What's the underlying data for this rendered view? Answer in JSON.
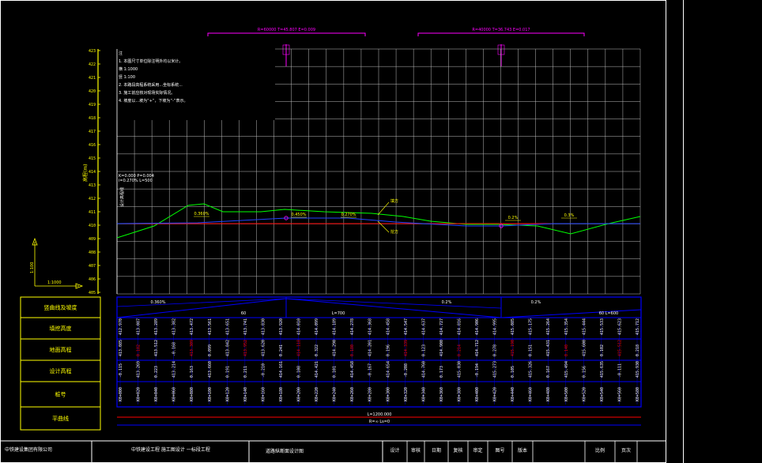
{
  "frame": {
    "bg": "#000000",
    "line": "#ffffff",
    "grid": "#c0c0c0",
    "yellow": "#ffff00",
    "magenta": "#ff00ff",
    "blue": "#0000ff",
    "red": "#ff0000",
    "green": "#00ff00"
  },
  "top_curves": [
    {
      "label": "R=60000 T=45.807 E=0.009"
    },
    {
      "label": "R=40000 T=36.743 E=0.017"
    }
  ],
  "notes": [
    "注",
    "1. 本图尺寸单位除注明外均以米计。",
    "   横 1:1000",
    "   竖 1:100",
    "2. 本路段高程系统采用...坐标系统...",
    "3. 施工前应核对现场实际情况。",
    "4. 坡度以...坡为“+”，下坡为“-”表示。"
  ],
  "profile_small_labels": [
    "K=0.000 P=0.004",
    "i=0.270% L=500"
  ],
  "profile_vlabel": "设计高程线",
  "slope_labels": [
    "0.360%",
    "0.450%",
    "0.270%",
    "0.2%",
    "0.3%"
  ],
  "side_tags": [
    "填方",
    "挖方"
  ],
  "yscale": [
    "423",
    "422",
    "421",
    "420",
    "419",
    "418",
    "417",
    "416",
    "415",
    "414",
    "413",
    "412",
    "411",
    "410",
    "409",
    "408",
    "407",
    "406",
    "405"
  ],
  "yscale_vlabel": "高程(m)",
  "legend": {
    "v": "1:100",
    "h": "1:1000"
  },
  "row_labels": [
    "竖曲线及坡度",
    "填挖高度",
    "地面高程",
    "设计高程",
    "桩号",
    "平曲线"
  ],
  "row_colors": [
    "#ffffff",
    "#ff0000",
    "#ffffff",
    "#ffffff",
    "#ffffff"
  ],
  "grade_row": [
    {
      "text": "0.360%"
    },
    {
      "text": "0.2%"
    },
    {
      "text": "0.2%"
    }
  ],
  "grade_sub": [
    "60",
    "L=700",
    "60 L=600"
  ],
  "columns": [
    [
      "412.970",
      "413.085",
      "-0.115",
      "K0+000",
      ""
    ],
    [
      "413.087",
      "0.182",
      "413.269",
      "K0+020",
      ""
    ],
    [
      "413.289",
      "413.512",
      "0.223",
      "K0+040",
      ""
    ],
    [
      "413.382",
      "-0.168",
      "413.214",
      "K0+060",
      ""
    ],
    [
      "413.472",
      "413.309",
      "0.163",
      "K0+080",
      ""
    ],
    [
      "413.561",
      "0.099",
      "413.660",
      "K0+100",
      ""
    ],
    [
      "413.651",
      "413.842",
      "0.191",
      "K0+120",
      ""
    ],
    [
      "413.741",
      "413.952",
      "0.211",
      "K0+140",
      ""
    ],
    [
      "413.830",
      "413.620",
      "-0.210",
      "K0+160",
      ""
    ],
    [
      "413.920",
      "0.241",
      "414.161",
      "K0+180",
      ""
    ],
    [
      "414.010",
      "414.118",
      "0.108",
      "K0+200",
      ""
    ],
    [
      "414.099",
      "0.322",
      "414.421",
      "K0+220",
      ""
    ],
    [
      "414.189",
      "414.290",
      "0.101",
      "K0+240",
      ""
    ],
    [
      "414.278",
      "0.180",
      "414.458",
      "K0+260",
      ""
    ],
    [
      "414.368",
      "414.201",
      "-0.167",
      "K0+280",
      ""
    ],
    [
      "414.458",
      "0.196",
      "414.654",
      "K0+300",
      ""
    ],
    [
      "414.547",
      "414.339",
      "-0.208",
      "K0+320",
      ""
    ],
    [
      "414.637",
      "0.123",
      "414.760",
      "K0+340",
      ""
    ],
    [
      "414.727",
      "414.900",
      "0.173",
      "K0+360",
      ""
    ],
    [
      "414.816",
      "0.214",
      "415.030",
      "K0+380",
      ""
    ],
    [
      "414.906",
      "414.712",
      "-0.194",
      "K0+400",
      ""
    ],
    [
      "414.995",
      "0.278",
      "415.273",
      "K0+420",
      ""
    ],
    [
      "415.085",
      "415.190",
      "0.105",
      "K0+440",
      ""
    ],
    [
      "415.175",
      "0.151",
      "415.326",
      "K0+460",
      ""
    ],
    [
      "415.264",
      "415.431",
      "0.167",
      "K0+480",
      ""
    ],
    [
      "415.354",
      "0.140",
      "415.494",
      "K0+500",
      ""
    ],
    [
      "415.444",
      "415.600",
      "0.156",
      "K0+520",
      ""
    ],
    [
      "415.533",
      "0.102",
      "415.635",
      "K0+540",
      ""
    ],
    [
      "415.623",
      "415.512",
      "-0.111",
      "K0+560",
      ""
    ],
    [
      "415.712",
      "0.218",
      "415.930",
      "K0+580",
      ""
    ]
  ],
  "bottom_lines": [
    "L=1200.000",
    "R=∞ Ls=0"
  ],
  "footer": {
    "company": "中铁建设集团有限公司",
    "project": "中铁建设工程 施工图设计 一标段工程",
    "drawing": "道路纵断面设计图",
    "cells": [
      "设计",
      "审核",
      "日期",
      "复核",
      "审定",
      "图号",
      "版本",
      "比例",
      "页次"
    ]
  }
}
